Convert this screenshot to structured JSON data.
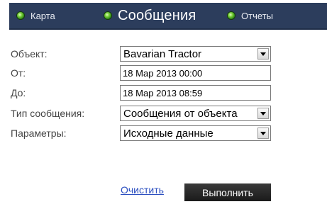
{
  "nav": {
    "items": [
      {
        "label": "Карта",
        "active": false
      },
      {
        "label": "Сообщения",
        "active": true
      },
      {
        "label": "Отчеты",
        "active": false
      }
    ]
  },
  "form": {
    "object_label": "Объект:",
    "object_value": "Bavarian Tractor",
    "from_label": "От:",
    "from_value": "18 Мар 2013 00:00",
    "to_label": "До:",
    "to_value": "18 Мар 2013 08:59",
    "message_type_label": "Тип сообщения:",
    "message_type_value": "Сообщения от объекта",
    "params_label": "Параметры:",
    "params_value": "Исходные данные"
  },
  "actions": {
    "clear_label": "Очистить",
    "run_label": "Выполнить"
  }
}
